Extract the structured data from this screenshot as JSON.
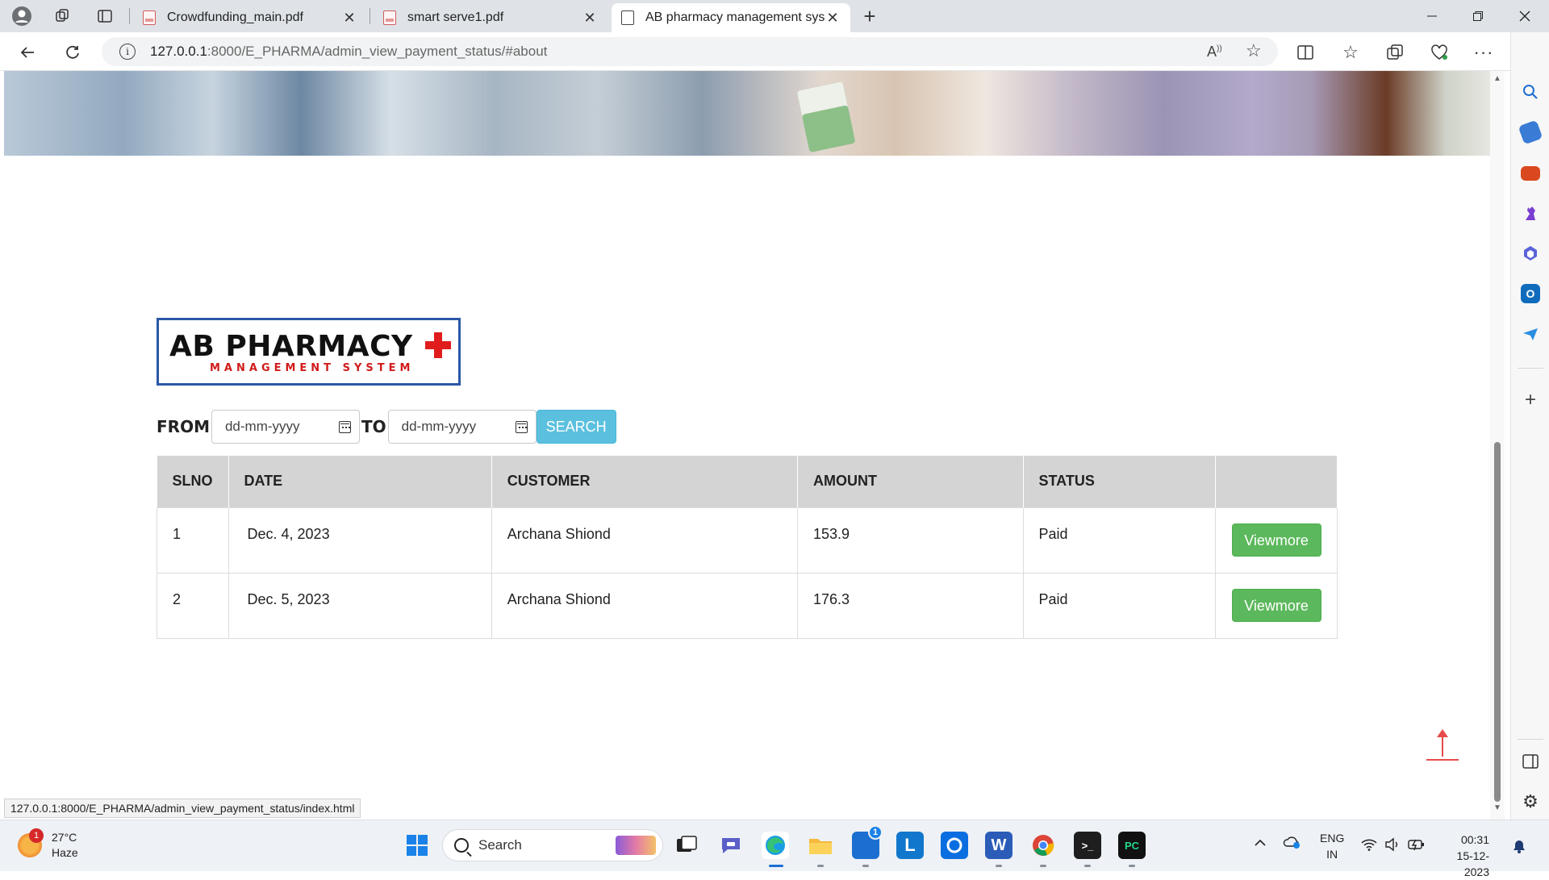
{
  "browser": {
    "tabs": [
      {
        "title": "Crowdfunding_main.pdf",
        "icon": "pdf-icon"
      },
      {
        "title": "smart serve1.pdf",
        "icon": "pdf-icon"
      },
      {
        "title": "AB pharmacy management syste",
        "icon": "page-icon",
        "active": true
      }
    ],
    "url_host": "127.0.0.1",
    "url_rest": ":8000/E_PHARMA/admin_view_payment_status/#about",
    "status_url": "127.0.0.1:8000/E_PHARMA/admin_view_payment_status/index.html"
  },
  "logo": {
    "title": "AB PHARMACY",
    "subtitle": "MANAGEMENT SYSTEM",
    "accent": "#e01c1c",
    "border": "#2a58a6"
  },
  "filter": {
    "from_label": "FROM",
    "to_label": "TO",
    "from_placeholder": "dd-mm-yyyy",
    "to_placeholder": "dd-mm-yyyy",
    "search_label": "SEARCH"
  },
  "table": {
    "headers": [
      "SLNO",
      "DATE",
      "CUSTOMER",
      "AMOUNT",
      "STATUS",
      ""
    ],
    "rows": [
      {
        "slno": "1",
        "date": "Dec. 4, 2023",
        "customer": "Archana Shiond",
        "amount": "153.9",
        "status": "Paid",
        "action": "Viewmore"
      },
      {
        "slno": "2",
        "date": "Dec. 5, 2023",
        "customer": "Archana Shiond",
        "amount": "176.3",
        "status": "Paid",
        "action": "Viewmore"
      }
    ]
  },
  "taskbar": {
    "weather_temp": "27°C",
    "weather_desc": "Haze",
    "weather_badge": "1",
    "search_label": "Search",
    "store_badge": "1",
    "lang_1": "ENG",
    "lang_2": "IN",
    "time": "00:31",
    "date": "15-12-2023"
  },
  "colors": {
    "search_button": "#5bc0de",
    "viewmore_button": "#5cb85c",
    "table_header": "#d4d4d4",
    "up_arrow": "#e84b4b"
  }
}
